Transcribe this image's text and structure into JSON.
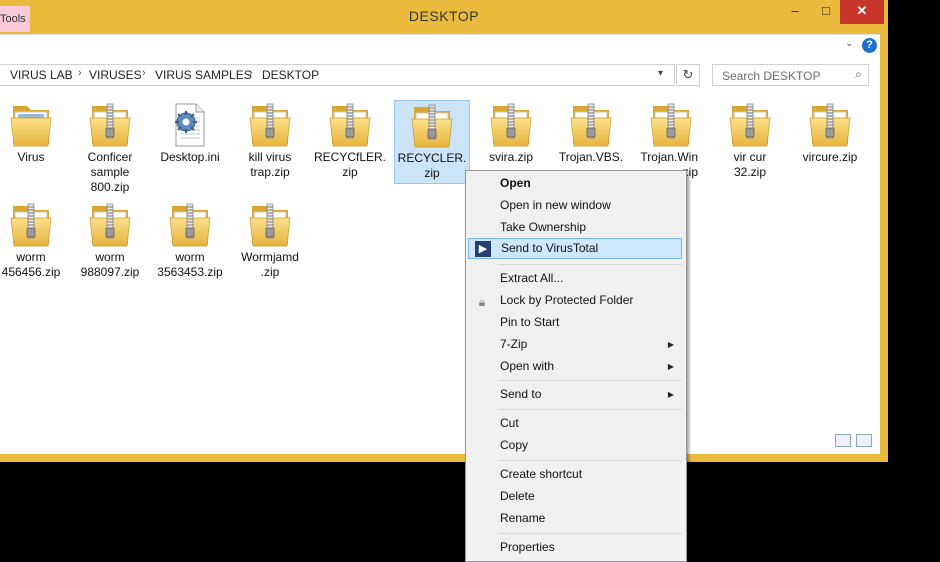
{
  "window": {
    "title": "DESKTOP",
    "tools_tab": "Tools",
    "controls": {
      "minimize": "–",
      "maximize": "□",
      "close": "✕"
    }
  },
  "ribbon": {
    "expand": "⌄",
    "help": "?"
  },
  "address_bar": {
    "crumbs": [
      "VIRUS LAB",
      "VIRUSES",
      "VIRUS SAMPLES",
      "DESKTOP"
    ],
    "separator": "›",
    "dropdown": "▾",
    "refresh": "↻"
  },
  "search": {
    "placeholder": "Search DESKTOP",
    "icon": "⌕"
  },
  "files": [
    {
      "name": "Virus",
      "kind": "folder"
    },
    {
      "name": "Conficer\nsample\n800.zip",
      "kind": "zip"
    },
    {
      "name": "Desktop.ini",
      "kind": "settings"
    },
    {
      "name": "kill virus\ntrap.zip",
      "kind": "zip"
    },
    {
      "name": "RECYCfLER.\nzip",
      "kind": "zip"
    },
    {
      "name": "RECYCLER.\nzip",
      "kind": "zip",
      "selected": true
    },
    {
      "name": "svira.zip",
      "kind": "zip"
    },
    {
      "name": "Trojan.VBS.",
      "kind": "zip"
    },
    {
      "name": "Trojan.Win\nzip",
      "kind": "zip"
    },
    {
      "name": "vir cur\n32.zip",
      "kind": "zip"
    },
    {
      "name": "vircure.zip",
      "kind": "zip"
    },
    {
      "name": "worm\n456456.zip",
      "kind": "zip"
    },
    {
      "name": "worm\n988097.zip",
      "kind": "zip"
    },
    {
      "name": "worm\n3563453.zip",
      "kind": "zip"
    },
    {
      "name": "Wormjamd\n.zip",
      "kind": "zip"
    }
  ],
  "context_menu": {
    "open": "Open",
    "open_new_window": "Open in new window",
    "take_ownership": "Take Ownership",
    "send_to_virustotal": "Send to VirusTotal",
    "extract_all": "Extract All...",
    "lock_folder": "Lock by Protected Folder",
    "pin_to_start": "Pin to Start",
    "seven_zip": "7-Zip",
    "open_with": "Open with",
    "send_to": "Send to",
    "cut": "Cut",
    "copy": "Copy",
    "create_shortcut": "Create shortcut",
    "delete": "Delete",
    "rename": "Rename",
    "properties": "Properties",
    "submenu_arrow": "▶"
  },
  "colors": {
    "frame": "#eaba3d",
    "close": "#c8352a",
    "selection": "#cce4f7",
    "menu_highlight": "#cde8ff"
  }
}
